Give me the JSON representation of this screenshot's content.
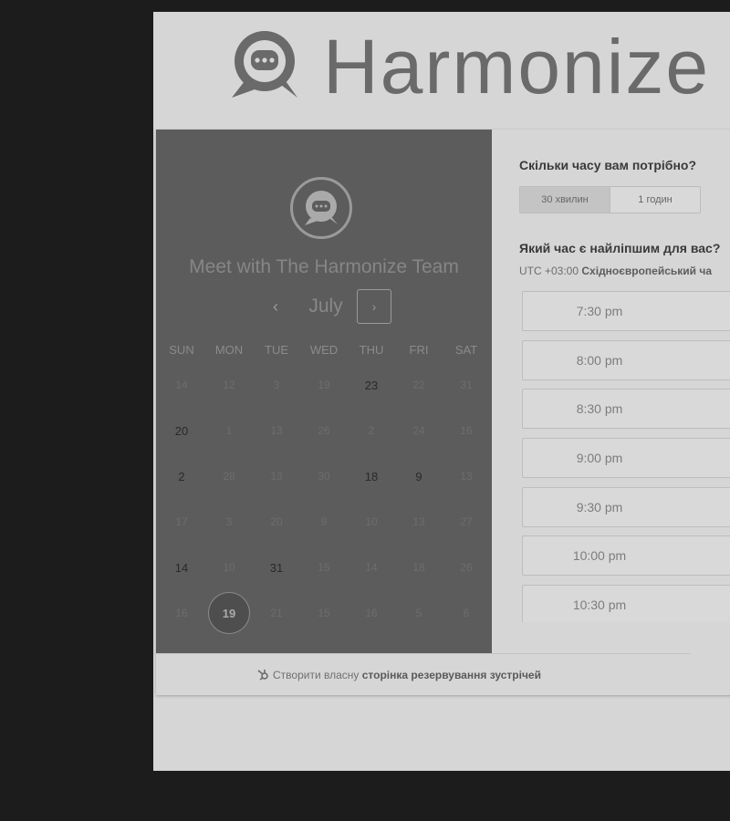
{
  "brand": {
    "name": "Harmonize"
  },
  "meeting": {
    "title": "Meet with The Harmonize Team"
  },
  "calendar": {
    "month": "July",
    "weekdays": [
      "SUN",
      "MON",
      "TUE",
      "WED",
      "THU",
      "FRI",
      "SAT"
    ],
    "weeks": [
      [
        {
          "d": "14",
          "a": false
        },
        {
          "d": "12",
          "a": false
        },
        {
          "d": "3",
          "a": false
        },
        {
          "d": "19",
          "a": false
        },
        {
          "d": "23",
          "a": true
        },
        {
          "d": "22",
          "a": false
        },
        {
          "d": "31",
          "a": false
        }
      ],
      [
        {
          "d": "20",
          "a": true
        },
        {
          "d": "1",
          "a": false
        },
        {
          "d": "13",
          "a": false
        },
        {
          "d": "26",
          "a": false
        },
        {
          "d": "2",
          "a": false
        },
        {
          "d": "24",
          "a": false
        },
        {
          "d": "16",
          "a": false
        }
      ],
      [
        {
          "d": "2",
          "a": true
        },
        {
          "d": "28",
          "a": false
        },
        {
          "d": "13",
          "a": false
        },
        {
          "d": "30",
          "a": false
        },
        {
          "d": "18",
          "a": true
        },
        {
          "d": "9",
          "a": true
        },
        {
          "d": "13",
          "a": false
        }
      ],
      [
        {
          "d": "17",
          "a": false
        },
        {
          "d": "3",
          "a": false
        },
        {
          "d": "20",
          "a": false
        },
        {
          "d": "9",
          "a": false
        },
        {
          "d": "10",
          "a": false
        },
        {
          "d": "13",
          "a": false
        },
        {
          "d": "27",
          "a": false
        }
      ],
      [
        {
          "d": "14",
          "a": true
        },
        {
          "d": "10",
          "a": false
        },
        {
          "d": "31",
          "a": true
        },
        {
          "d": "15",
          "a": false
        },
        {
          "d": "14",
          "a": false
        },
        {
          "d": "18",
          "a": false
        },
        {
          "d": "26",
          "a": false
        }
      ],
      [
        {
          "d": "16",
          "a": false
        },
        {
          "d": "19",
          "a": true,
          "sel": true
        },
        {
          "d": "21",
          "a": false
        },
        {
          "d": "15",
          "a": false
        },
        {
          "d": "16",
          "a": false
        },
        {
          "d": "5",
          "a": false
        },
        {
          "d": "6",
          "a": false
        }
      ]
    ]
  },
  "right": {
    "duration_question": "Скільки часу вам потрібно?",
    "durations": [
      "30 хвилин",
      "1 годин"
    ],
    "active_duration": 0,
    "time_question": "Який час є найліпшим для вас?",
    "tz_offset": "UTC +03:00",
    "tz_name": "Східноєвропейський ча",
    "slots": [
      "7:30 pm",
      "8:00 pm",
      "8:30 pm",
      "9:00 pm",
      "9:30 pm",
      "10:00 pm",
      "10:30 pm"
    ]
  },
  "footer": {
    "prefix": "Створити власну",
    "link": "сторінка резервування зустрічей"
  }
}
